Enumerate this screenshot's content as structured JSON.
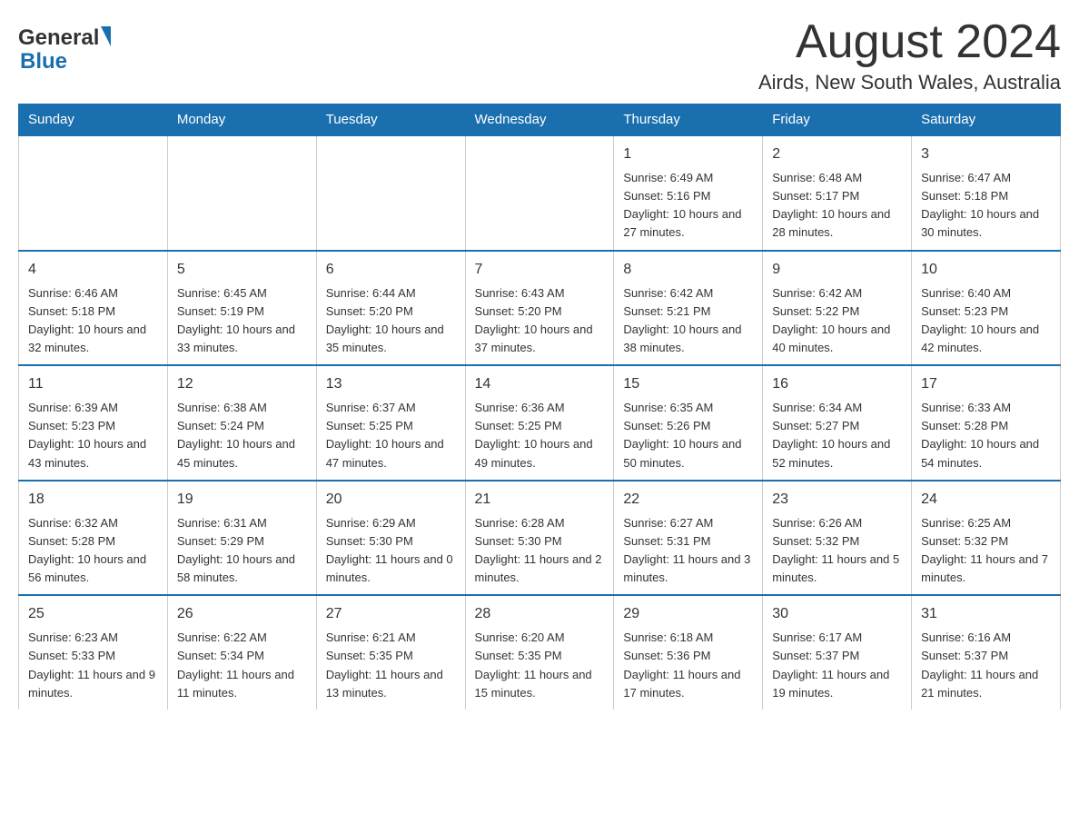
{
  "header": {
    "logo_general": "General",
    "logo_blue": "Blue",
    "month_title": "August 2024",
    "location": "Airds, New South Wales, Australia"
  },
  "days_of_week": [
    "Sunday",
    "Monday",
    "Tuesday",
    "Wednesday",
    "Thursday",
    "Friday",
    "Saturday"
  ],
  "weeks": [
    {
      "days": [
        {
          "num": "",
          "sunrise": "",
          "sunset": "",
          "daylight": ""
        },
        {
          "num": "",
          "sunrise": "",
          "sunset": "",
          "daylight": ""
        },
        {
          "num": "",
          "sunrise": "",
          "sunset": "",
          "daylight": ""
        },
        {
          "num": "",
          "sunrise": "",
          "sunset": "",
          "daylight": ""
        },
        {
          "num": "1",
          "sunrise": "Sunrise: 6:49 AM",
          "sunset": "Sunset: 5:16 PM",
          "daylight": "Daylight: 10 hours and 27 minutes."
        },
        {
          "num": "2",
          "sunrise": "Sunrise: 6:48 AM",
          "sunset": "Sunset: 5:17 PM",
          "daylight": "Daylight: 10 hours and 28 minutes."
        },
        {
          "num": "3",
          "sunrise": "Sunrise: 6:47 AM",
          "sunset": "Sunset: 5:18 PM",
          "daylight": "Daylight: 10 hours and 30 minutes."
        }
      ]
    },
    {
      "days": [
        {
          "num": "4",
          "sunrise": "Sunrise: 6:46 AM",
          "sunset": "Sunset: 5:18 PM",
          "daylight": "Daylight: 10 hours and 32 minutes."
        },
        {
          "num": "5",
          "sunrise": "Sunrise: 6:45 AM",
          "sunset": "Sunset: 5:19 PM",
          "daylight": "Daylight: 10 hours and 33 minutes."
        },
        {
          "num": "6",
          "sunrise": "Sunrise: 6:44 AM",
          "sunset": "Sunset: 5:20 PM",
          "daylight": "Daylight: 10 hours and 35 minutes."
        },
        {
          "num": "7",
          "sunrise": "Sunrise: 6:43 AM",
          "sunset": "Sunset: 5:20 PM",
          "daylight": "Daylight: 10 hours and 37 minutes."
        },
        {
          "num": "8",
          "sunrise": "Sunrise: 6:42 AM",
          "sunset": "Sunset: 5:21 PM",
          "daylight": "Daylight: 10 hours and 38 minutes."
        },
        {
          "num": "9",
          "sunrise": "Sunrise: 6:42 AM",
          "sunset": "Sunset: 5:22 PM",
          "daylight": "Daylight: 10 hours and 40 minutes."
        },
        {
          "num": "10",
          "sunrise": "Sunrise: 6:40 AM",
          "sunset": "Sunset: 5:23 PM",
          "daylight": "Daylight: 10 hours and 42 minutes."
        }
      ]
    },
    {
      "days": [
        {
          "num": "11",
          "sunrise": "Sunrise: 6:39 AM",
          "sunset": "Sunset: 5:23 PM",
          "daylight": "Daylight: 10 hours and 43 minutes."
        },
        {
          "num": "12",
          "sunrise": "Sunrise: 6:38 AM",
          "sunset": "Sunset: 5:24 PM",
          "daylight": "Daylight: 10 hours and 45 minutes."
        },
        {
          "num": "13",
          "sunrise": "Sunrise: 6:37 AM",
          "sunset": "Sunset: 5:25 PM",
          "daylight": "Daylight: 10 hours and 47 minutes."
        },
        {
          "num": "14",
          "sunrise": "Sunrise: 6:36 AM",
          "sunset": "Sunset: 5:25 PM",
          "daylight": "Daylight: 10 hours and 49 minutes."
        },
        {
          "num": "15",
          "sunrise": "Sunrise: 6:35 AM",
          "sunset": "Sunset: 5:26 PM",
          "daylight": "Daylight: 10 hours and 50 minutes."
        },
        {
          "num": "16",
          "sunrise": "Sunrise: 6:34 AM",
          "sunset": "Sunset: 5:27 PM",
          "daylight": "Daylight: 10 hours and 52 minutes."
        },
        {
          "num": "17",
          "sunrise": "Sunrise: 6:33 AM",
          "sunset": "Sunset: 5:28 PM",
          "daylight": "Daylight: 10 hours and 54 minutes."
        }
      ]
    },
    {
      "days": [
        {
          "num": "18",
          "sunrise": "Sunrise: 6:32 AM",
          "sunset": "Sunset: 5:28 PM",
          "daylight": "Daylight: 10 hours and 56 minutes."
        },
        {
          "num": "19",
          "sunrise": "Sunrise: 6:31 AM",
          "sunset": "Sunset: 5:29 PM",
          "daylight": "Daylight: 10 hours and 58 minutes."
        },
        {
          "num": "20",
          "sunrise": "Sunrise: 6:29 AM",
          "sunset": "Sunset: 5:30 PM",
          "daylight": "Daylight: 11 hours and 0 minutes."
        },
        {
          "num": "21",
          "sunrise": "Sunrise: 6:28 AM",
          "sunset": "Sunset: 5:30 PM",
          "daylight": "Daylight: 11 hours and 2 minutes."
        },
        {
          "num": "22",
          "sunrise": "Sunrise: 6:27 AM",
          "sunset": "Sunset: 5:31 PM",
          "daylight": "Daylight: 11 hours and 3 minutes."
        },
        {
          "num": "23",
          "sunrise": "Sunrise: 6:26 AM",
          "sunset": "Sunset: 5:32 PM",
          "daylight": "Daylight: 11 hours and 5 minutes."
        },
        {
          "num": "24",
          "sunrise": "Sunrise: 6:25 AM",
          "sunset": "Sunset: 5:32 PM",
          "daylight": "Daylight: 11 hours and 7 minutes."
        }
      ]
    },
    {
      "days": [
        {
          "num": "25",
          "sunrise": "Sunrise: 6:23 AM",
          "sunset": "Sunset: 5:33 PM",
          "daylight": "Daylight: 11 hours and 9 minutes."
        },
        {
          "num": "26",
          "sunrise": "Sunrise: 6:22 AM",
          "sunset": "Sunset: 5:34 PM",
          "daylight": "Daylight: 11 hours and 11 minutes."
        },
        {
          "num": "27",
          "sunrise": "Sunrise: 6:21 AM",
          "sunset": "Sunset: 5:35 PM",
          "daylight": "Daylight: 11 hours and 13 minutes."
        },
        {
          "num": "28",
          "sunrise": "Sunrise: 6:20 AM",
          "sunset": "Sunset: 5:35 PM",
          "daylight": "Daylight: 11 hours and 15 minutes."
        },
        {
          "num": "29",
          "sunrise": "Sunrise: 6:18 AM",
          "sunset": "Sunset: 5:36 PM",
          "daylight": "Daylight: 11 hours and 17 minutes."
        },
        {
          "num": "30",
          "sunrise": "Sunrise: 6:17 AM",
          "sunset": "Sunset: 5:37 PM",
          "daylight": "Daylight: 11 hours and 19 minutes."
        },
        {
          "num": "31",
          "sunrise": "Sunrise: 6:16 AM",
          "sunset": "Sunset: 5:37 PM",
          "daylight": "Daylight: 11 hours and 21 minutes."
        }
      ]
    }
  ]
}
